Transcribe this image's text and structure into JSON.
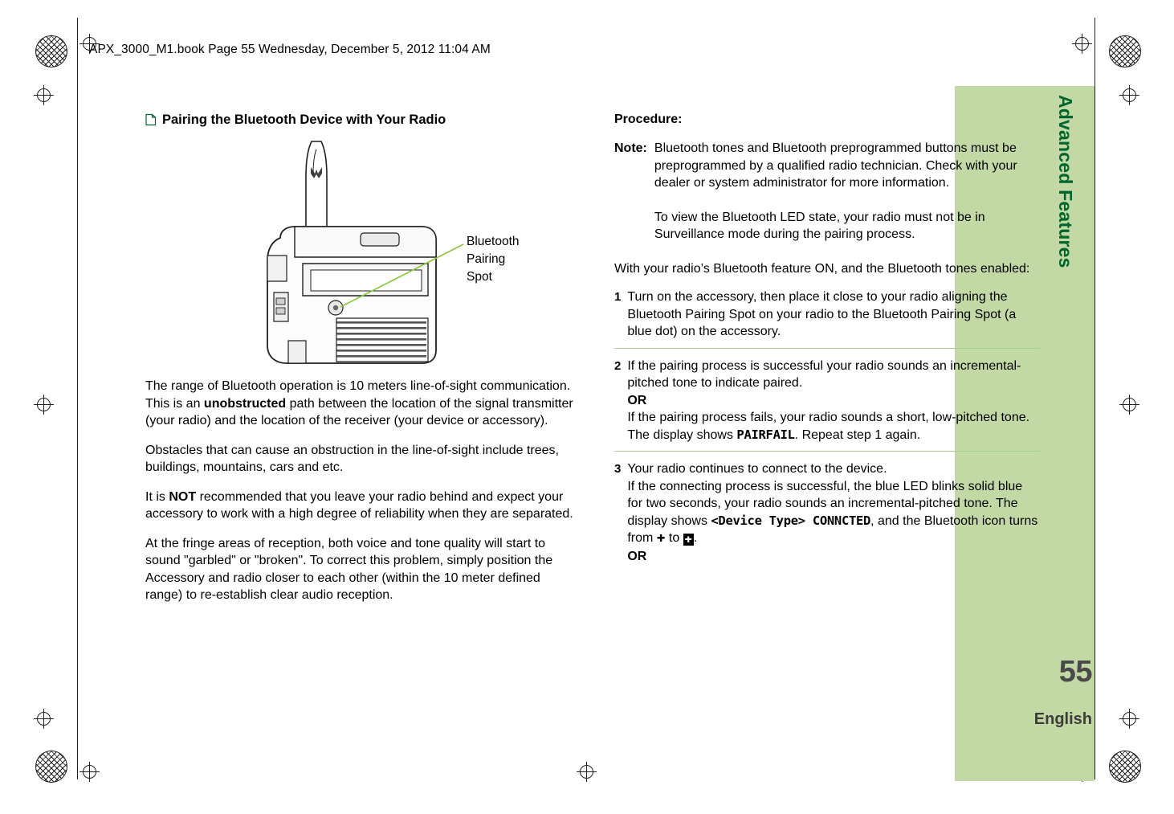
{
  "header": {
    "book_line": "APX_3000_M1.book  Page 55  Wednesday, December 5, 2012  11:04 AM"
  },
  "side_tab": {
    "chapter_label": "Advanced Features",
    "page_number": "55",
    "language": "English"
  },
  "left_column": {
    "heading": "Pairing the Bluetooth Device with Your Radio",
    "figure_callout": "Bluetooth\nPairing\nSpot",
    "paragraphs": [
      {
        "parts": [
          {
            "t": "The range of Bluetooth operation is 10 meters line-of-sight communication. This is an ",
            "b": false
          },
          {
            "t": "unobstructed",
            "b": true
          },
          {
            "t": " path between the location of the signal transmitter (your radio) and the location of the receiver (your device or accessory).",
            "b": false
          }
        ]
      },
      {
        "parts": [
          {
            "t": "Obstacles that can cause an obstruction in the line-of-sight include trees, buildings, mountains, cars and etc.",
            "b": false
          }
        ]
      },
      {
        "parts": [
          {
            "t": "It is ",
            "b": false
          },
          {
            "t": "NOT",
            "b": true
          },
          {
            "t": " recommended that you leave your radio behind and expect your accessory to work with a high degree of reliability when they are separated.",
            "b": false
          }
        ]
      },
      {
        "parts": [
          {
            "t": "At the fringe areas of reception, both voice and tone quality will start to sound \"garbled\" or \"broken\". To correct this problem, simply position the Accessory and radio closer to each other (within the 10 meter defined range) to re-establish clear audio reception.",
            "b": false
          }
        ]
      }
    ]
  },
  "right_column": {
    "procedure_title": "Procedure:",
    "note_label": "Note:",
    "note_paragraph_1": "Bluetooth tones and Bluetooth preprogrammed buttons must be preprogrammed by a qualified radio technician. Check with your dealer or system administrator for more information.",
    "note_paragraph_2": "To view the Bluetooth LED state, your radio must not be in Surveillance mode during the pairing process.",
    "intro": "With your radio’s Bluetooth feature ON, and the Bluetooth tones enabled:",
    "steps": [
      {
        "number": "1",
        "segments": [
          {
            "t": "Turn on the accessory, then place it close to your radio aligning the Bluetooth Pairing Spot on your radio to the Bluetooth Pairing Spot (a blue dot) on the accessory.",
            "style": "normal"
          }
        ]
      },
      {
        "number": "2",
        "segments": [
          {
            "t": "If the pairing process is successful your radio sounds an incremental-pitched tone to indicate paired.",
            "style": "normal"
          },
          {
            "t": "OR",
            "style": "bold-line"
          },
          {
            "t": "If the pairing process fails, your radio sounds a short, low-pitched tone. The display shows ",
            "style": "normal"
          },
          {
            "t": "PAIRFAIL",
            "style": "display"
          },
          {
            "t": ". Repeat step 1 again.",
            "style": "normal"
          }
        ]
      },
      {
        "number": "3",
        "segments": [
          {
            "t": "Your radio continues to connect to the device.",
            "style": "normal"
          },
          {
            "t": "If the connecting process is successful, the blue LED blinks solid blue for two seconds, your radio sounds an incremental-pitched tone. The display shows ",
            "style": "newline-normal"
          },
          {
            "t": "<Device Type> CONNCTED",
            "style": "display"
          },
          {
            "t": ", and the Bluetooth icon turns from ",
            "style": "normal"
          },
          {
            "t": "bluetooth-icon-outline",
            "style": "icon"
          },
          {
            "t": " to ",
            "style": "normal"
          },
          {
            "t": "bluetooth-icon-inverted",
            "style": "icon-inv"
          },
          {
            "t": ".",
            "style": "normal"
          },
          {
            "t": "OR",
            "style": "bold-line"
          }
        ]
      }
    ]
  },
  "colors": {
    "tab_green": "#c3d9a5",
    "tab_text_green": "#00662e",
    "rule_green": "#a8d08d",
    "callout_line": "#8cc63f"
  }
}
